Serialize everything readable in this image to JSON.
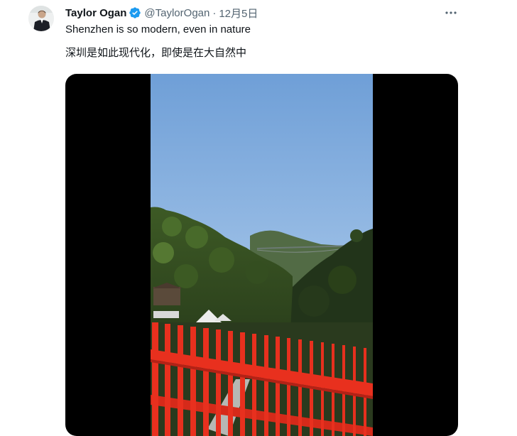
{
  "tweet": {
    "display_name": "Taylor Ogan",
    "handle": "@TaylorOgan",
    "separator": "·",
    "date": "12月5日",
    "text_en": "Shenzhen is so modern, even in nature",
    "text_zh": "深圳是如此现代化，即使是在大自然中",
    "icons": {
      "verified": "verified-badge-icon",
      "more": "more-horizontal-icon"
    },
    "colors": {
      "verified": "#1d9bf0",
      "secondary_text": "#536471",
      "railing": "#e8301e"
    }
  }
}
